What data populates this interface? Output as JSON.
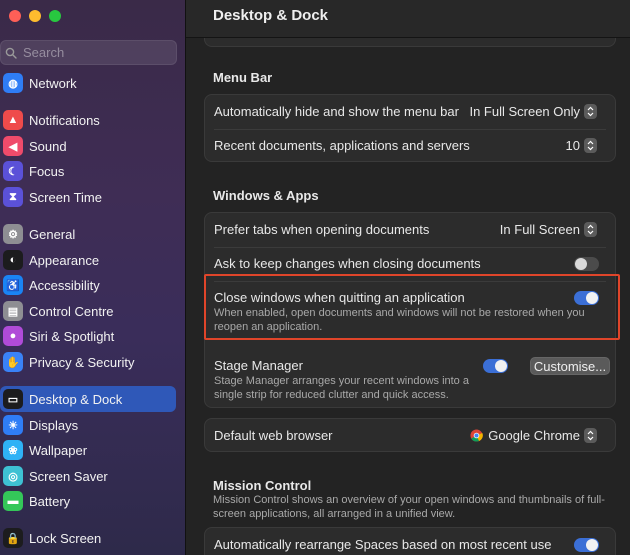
{
  "window": {
    "title": "Desktop & Dock"
  },
  "search": {
    "placeholder": "Search"
  },
  "sidebar": {
    "items": [
      {
        "label": "Network",
        "icon": "globe-icon",
        "color": "#2f7df6"
      },
      {
        "label": "Notifications",
        "icon": "bell-icon",
        "color": "#ef4b4b"
      },
      {
        "label": "Sound",
        "icon": "speaker-icon",
        "color": "#ef4b6b"
      },
      {
        "label": "Focus",
        "icon": "moon-icon",
        "color": "#5b51d8"
      },
      {
        "label": "Screen Time",
        "icon": "hourglass-icon",
        "color": "#5b51d8"
      },
      {
        "label": "General",
        "icon": "gear-icon",
        "color": "#8e8e93"
      },
      {
        "label": "Appearance",
        "icon": "appearance-icon",
        "color": "#1c1c1e"
      },
      {
        "label": "Accessibility",
        "icon": "accessibility-icon",
        "color": "#1a84f4"
      },
      {
        "label": "Control Centre",
        "icon": "control-centre-icon",
        "color": "#8e8e93"
      },
      {
        "label": "Siri & Spotlight",
        "icon": "siri-icon",
        "color": "#b04bd8"
      },
      {
        "label": "Privacy & Security",
        "icon": "hand-icon",
        "color": "#3a82f7"
      },
      {
        "label": "Desktop & Dock",
        "icon": "dock-icon",
        "color": "#1c1c1e"
      },
      {
        "label": "Displays",
        "icon": "display-icon",
        "color": "#2f7df6"
      },
      {
        "label": "Wallpaper",
        "icon": "wallpaper-icon",
        "color": "#2fb2f6"
      },
      {
        "label": "Screen Saver",
        "icon": "screensaver-icon",
        "color": "#3ec1d3"
      },
      {
        "label": "Battery",
        "icon": "battery-icon",
        "color": "#34c759"
      },
      {
        "label": "Lock Screen",
        "icon": "lock-icon",
        "color": "#1c1c1e"
      }
    ],
    "active": "Desktop & Dock"
  },
  "menu_bar": {
    "title": "Menu Bar",
    "auto_hide_label": "Automatically hide and show the menu bar",
    "auto_hide_value": "In Full Screen Only",
    "recent_label": "Recent documents, applications and servers",
    "recent_value": "10"
  },
  "windows_apps": {
    "title": "Windows & Apps",
    "prefer_tabs_label": "Prefer tabs when opening documents",
    "prefer_tabs_value": "In Full Screen",
    "ask_keep_label": "Ask to keep changes when closing documents",
    "ask_keep_on": false,
    "close_windows_label": "Close windows when quitting an application",
    "close_windows_desc": "When enabled, open documents and windows will not be restored when you reopen an application.",
    "close_windows_on": true,
    "stage_manager_label": "Stage Manager",
    "stage_manager_desc": "Stage Manager arranges your recent windows into a single strip for reduced clutter and quick access.",
    "stage_manager_on": true,
    "customise_label": "Customise...",
    "browser_label": "Default web browser",
    "browser_value": "Google Chrome"
  },
  "mission_control": {
    "title": "Mission Control",
    "desc": "Mission Control shows an overview of your open windows and thumbnails of full-screen applications, all arranged in a unified view.",
    "rearrange_label": "Automatically rearrange Spaces based on most recent use",
    "rearrange_on": true
  },
  "colors": {
    "accent": "#3b6fd6",
    "highlight": "#e0452a",
    "sidebar_active": "#2f58b8"
  }
}
